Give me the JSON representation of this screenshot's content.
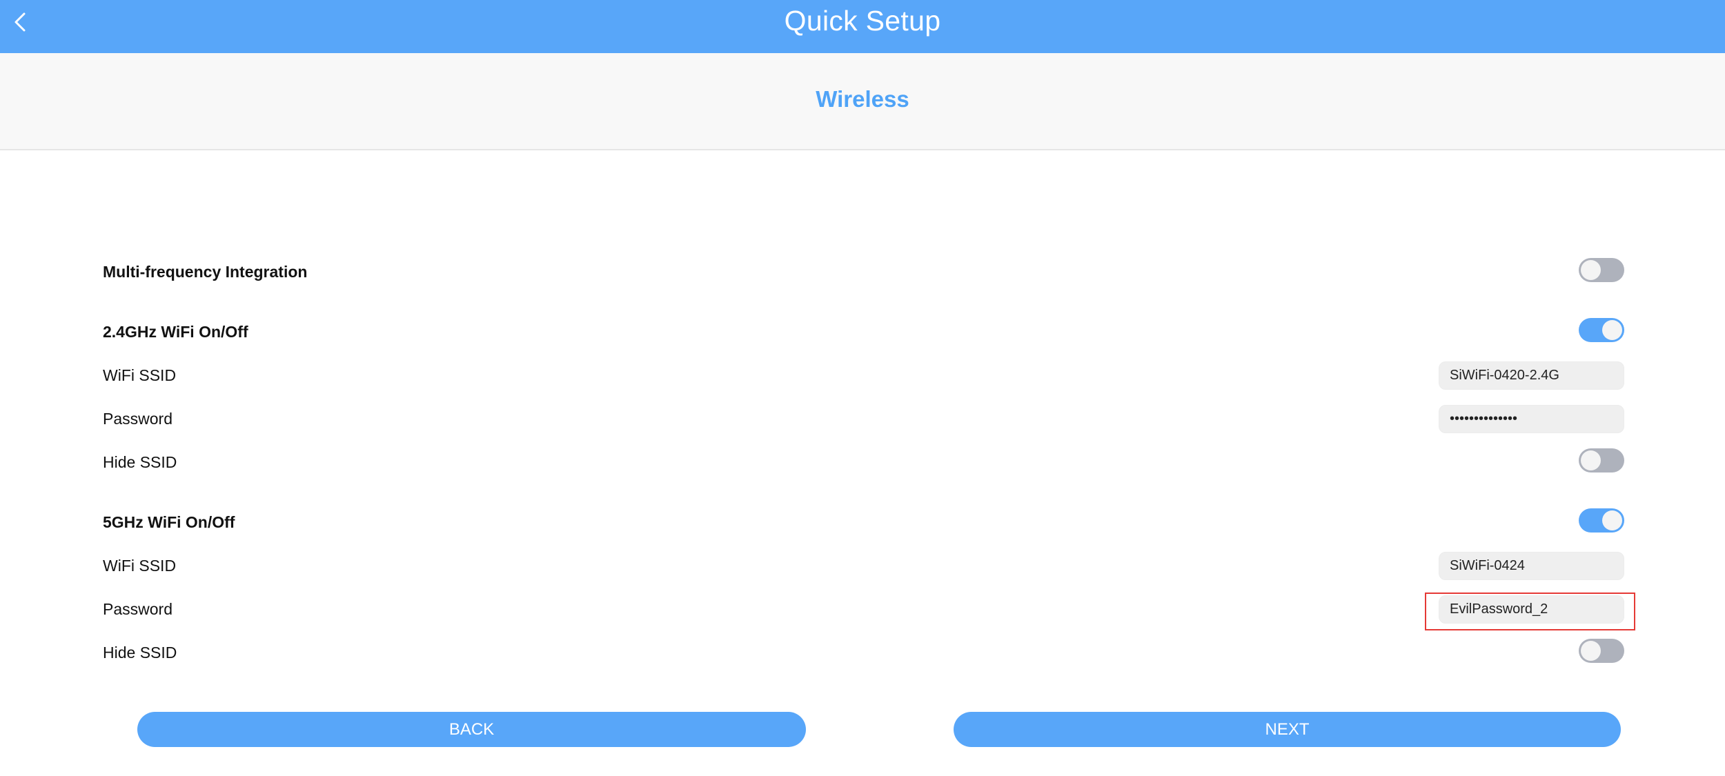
{
  "header": {
    "title": "Quick Setup",
    "back_icon": "chevron-left-icon",
    "background_color": "#58a6f9"
  },
  "section": {
    "title": "Wireless",
    "title_color": "#4fa3f7"
  },
  "form": {
    "multi_frequency": {
      "label": "Multi-frequency Integration",
      "enabled": false
    },
    "band_24": {
      "label": "2.4GHz WiFi On/Off",
      "enabled": true,
      "ssid_label": "WiFi SSID",
      "ssid_value": "SiWiFi-0420-2.4G",
      "password_label": "Password",
      "password_value": "••••••••••••••",
      "hide_ssid_label": "Hide SSID",
      "hide_ssid": false
    },
    "band_5": {
      "label": "5GHz WiFi On/Off",
      "enabled": true,
      "ssid_label": "WiFi SSID",
      "ssid_value": "SiWiFi-0424",
      "password_label": "Password",
      "password_value": "EvilPassword_2",
      "hide_ssid_label": "Hide SSID",
      "hide_ssid": false
    }
  },
  "buttons": {
    "back_label": "BACK",
    "next_label": "NEXT"
  },
  "colors": {
    "accent": "#58a6f9",
    "toggle_off": "#aeb2bc",
    "highlight": "#e53935"
  }
}
